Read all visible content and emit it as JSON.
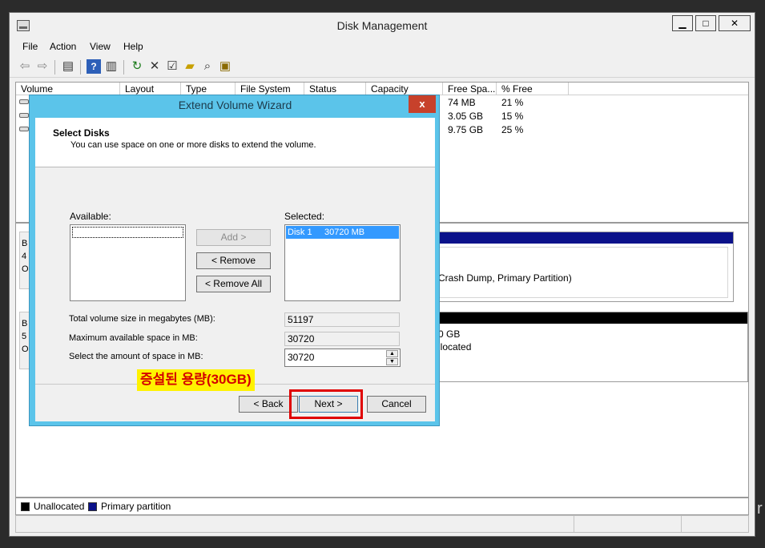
{
  "window": {
    "title": "Disk Management",
    "minimize": "▁",
    "maximize": "□",
    "close": "✕"
  },
  "menu": [
    "File",
    "Action",
    "View",
    "Help"
  ],
  "toolbar": [
    "back-icon",
    "forward-icon",
    "show-hide-console-tree-icon",
    "help-icon",
    "properties-pane-icon",
    "refresh-icon",
    "delete-icon",
    "properties-icon",
    "open-folder-icon",
    "search-icon",
    "rescan-disks-icon"
  ],
  "columns": [
    "Volume",
    "Layout",
    "Type",
    "File System",
    "Status",
    "Capacity",
    "Free Spa...",
    "% Free"
  ],
  "rows": [
    {
      "free": "74 MB",
      "pct": "21 %"
    },
    {
      "free": "3.05 GB",
      "pct": "15 %"
    },
    {
      "free": "9.75 GB",
      "pct": "25 %"
    }
  ],
  "disk_fragments": {
    "d0_lines": [
      "B",
      "4",
      "O"
    ],
    "d0_partition": "Crash Dump, Primary Partition)",
    "d1_lines": [
      "B",
      "5",
      "O"
    ],
    "d1_size": "0 GB",
    "d1_status": "llocated"
  },
  "legend": [
    {
      "label": "Unallocated",
      "color": "#000000"
    },
    {
      "label": "Primary partition",
      "color": "#0b128a"
    }
  ],
  "dialog": {
    "title": "Extend Volume Wizard",
    "close": "x",
    "header_title": "Select Disks",
    "header_desc": "You can use space on one or more disks to extend the volume.",
    "available_label": "Available:",
    "selected_label": "Selected:",
    "selected_items": [
      {
        "disk": "Disk 1",
        "size": "30720 MB"
      }
    ],
    "add_btn": "Add >",
    "remove_btn": "< Remove",
    "remove_all_btn": "< Remove All",
    "total_label": "Total volume size in megabytes (MB):",
    "total_value": "51197",
    "max_label": "Maximum available space in MB:",
    "max_value": "30720",
    "amount_label": "Select the amount of space in MB:",
    "amount_value": "30720",
    "back_btn": "< Back",
    "next_btn": "Next >",
    "cancel_btn": "Cancel"
  },
  "annotation": {
    "text": "증설된 용량(30GB)",
    "highlight": "#fff200",
    "text_color": "#d40000",
    "box_color": "#e00000"
  },
  "accent": {
    "selection": "#3399ff",
    "dialog_frame": "#5bc4ea",
    "primary_partition": "#0b128a"
  },
  "edge_glyph": "r"
}
